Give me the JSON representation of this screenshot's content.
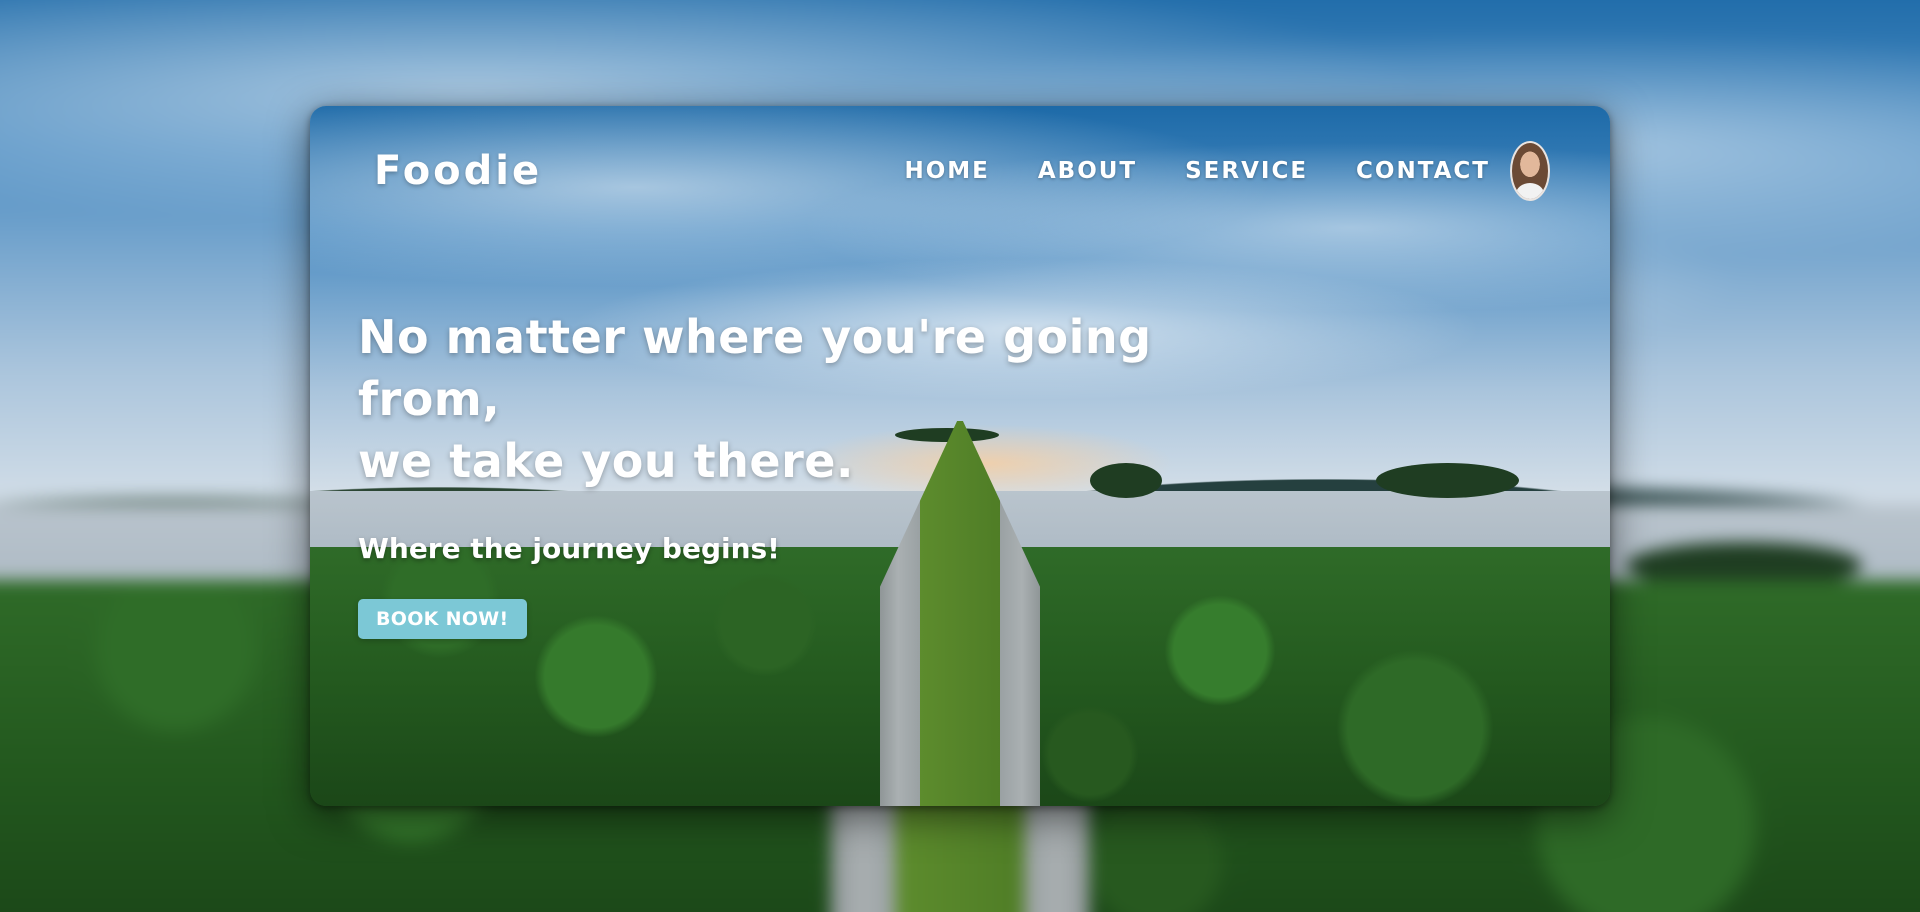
{
  "brand": {
    "name": "Foodie"
  },
  "nav": {
    "items": [
      {
        "label": "HOME"
      },
      {
        "label": "ABOUT"
      },
      {
        "label": "SERVICE"
      },
      {
        "label": "CONTACT"
      }
    ],
    "avatar_icon": "user-avatar-icon"
  },
  "hero": {
    "title": "No matter where you're going from,\nwe take you there.",
    "subtitle": "Where the journey begins!",
    "cta_label": "BOOK NOW!"
  },
  "colors": {
    "text": "#ffffff",
    "cta_background": "#7cc8d6"
  }
}
